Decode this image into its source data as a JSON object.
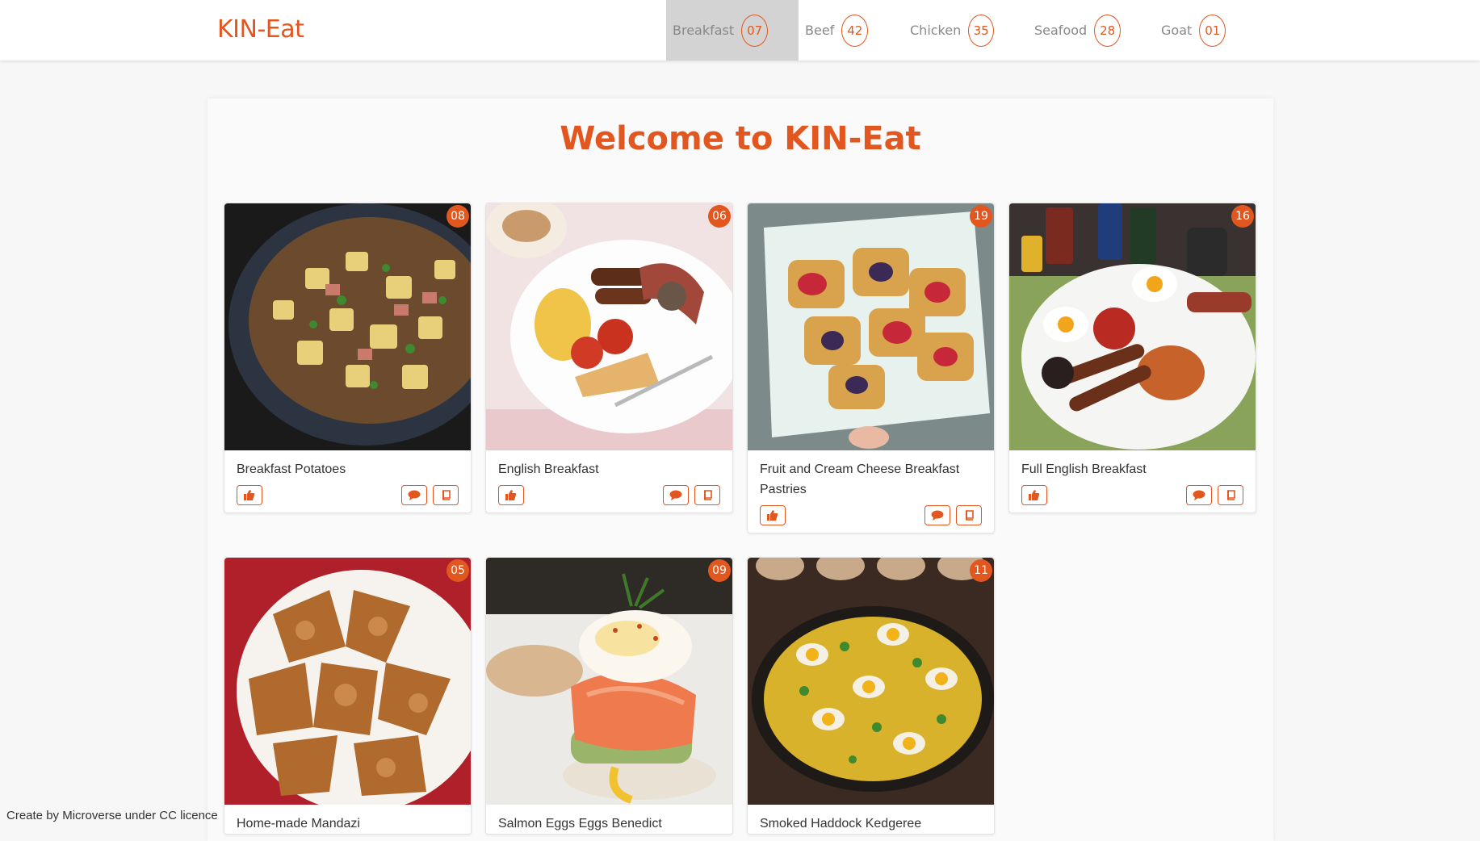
{
  "brand": "KIN-Eat",
  "nav": [
    {
      "label": "Breakfast",
      "count": "07",
      "active": true
    },
    {
      "label": "Beef",
      "count": "42"
    },
    {
      "label": "Chicken",
      "count": "35"
    },
    {
      "label": "Seafood",
      "count": "28"
    },
    {
      "label": "Goat",
      "count": "01"
    }
  ],
  "welcome": "Welcome to KIN-Eat",
  "cards": [
    {
      "title": "Breakfast Potatoes",
      "badge": "08"
    },
    {
      "title": "English Breakfast",
      "badge": "06"
    },
    {
      "title": "Fruit and Cream Cheese Breakfast Pastries",
      "badge": "19"
    },
    {
      "title": "Full English Breakfast",
      "badge": "16"
    },
    {
      "title": "Home-made Mandazi",
      "badge": "05"
    },
    {
      "title": "Salmon Eggs Eggs Benedict",
      "badge": "09"
    },
    {
      "title": "Smoked Haddock Kedgeree",
      "badge": "11"
    }
  ],
  "footer": "Create by Microverse under CC licence",
  "icons": {
    "like": "thumbs-up-icon",
    "comment": "comment-icon",
    "recipe": "book-icon"
  },
  "colors": {
    "accent": "#e2571f",
    "active_nav_bg": "#d3d3d3"
  }
}
